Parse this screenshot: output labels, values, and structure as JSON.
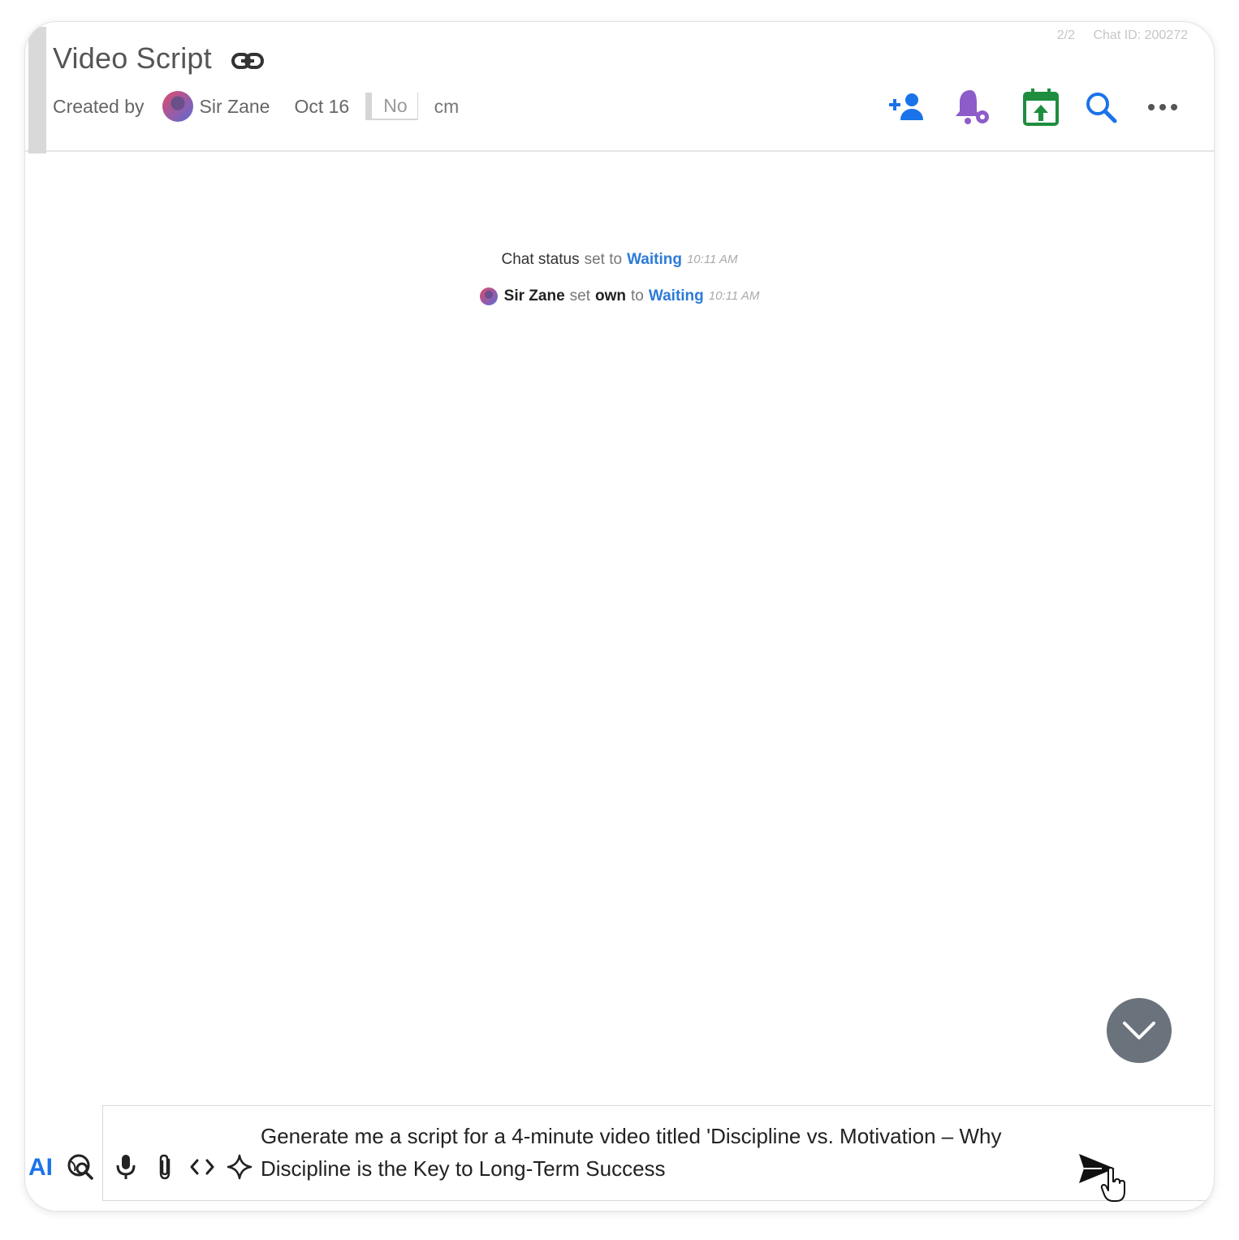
{
  "header": {
    "title": "Video Script",
    "counter": "2/2",
    "chat_id": "Chat ID: 200272",
    "created_by_label": "Created by",
    "creator_name": "Sir Zane",
    "date": "Oct 16",
    "no_field": "No",
    "cm_field": "cm"
  },
  "toolbar": {
    "icons": [
      "add-person-icon",
      "bell-settings-icon",
      "calendar-upload-icon",
      "search-icon",
      "more-icon"
    ],
    "colors": {
      "add_person": "#1a73e8",
      "bell": "#8e5cc9",
      "calendar": "#1e8e3e",
      "search": "#1a73e8",
      "more": "#555555"
    }
  },
  "events": [
    {
      "prefix": "Chat status",
      "middle": "set to",
      "status": "Waiting",
      "time": "10:11 AM"
    },
    {
      "actor": "Sir Zane",
      "verb": "set",
      "object": "own",
      "to": "to",
      "status": "Waiting",
      "time": "10:11 AM"
    }
  ],
  "composer": {
    "ai_label": "AI",
    "message_line1": "Generate me a script for a 4-minute video titled 'Discipline vs. Motivation – Why",
    "message_line2": "Discipline is the Key to Long-Term Success"
  },
  "accent": "#1a73e8"
}
